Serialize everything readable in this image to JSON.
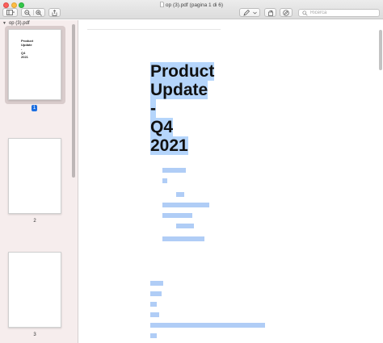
{
  "window": {
    "title": "op (3).pdf (pagina 1 di 6)",
    "search_placeholder": "Ricerca"
  },
  "sidebar": {
    "file_label": "op (3).pdf",
    "selected_page": 1,
    "thumbnails": [
      {
        "page": "1",
        "lines": [
          "Product",
          "Update",
          "-",
          "Q4",
          "2021"
        ]
      },
      {
        "page": "2"
      },
      {
        "page": "3"
      }
    ]
  },
  "document": {
    "title_lines": [
      "Product",
      "Update",
      "-",
      "Q4",
      "2021"
    ],
    "selection_color": "#b5d5fb"
  },
  "colors": {
    "sidebar_bg": "#f6eded",
    "selection_badge": "#1d6fe1",
    "traffic_red": "#fc605c",
    "traffic_yellow": "#fdbc40",
    "traffic_green": "#34c84a"
  }
}
